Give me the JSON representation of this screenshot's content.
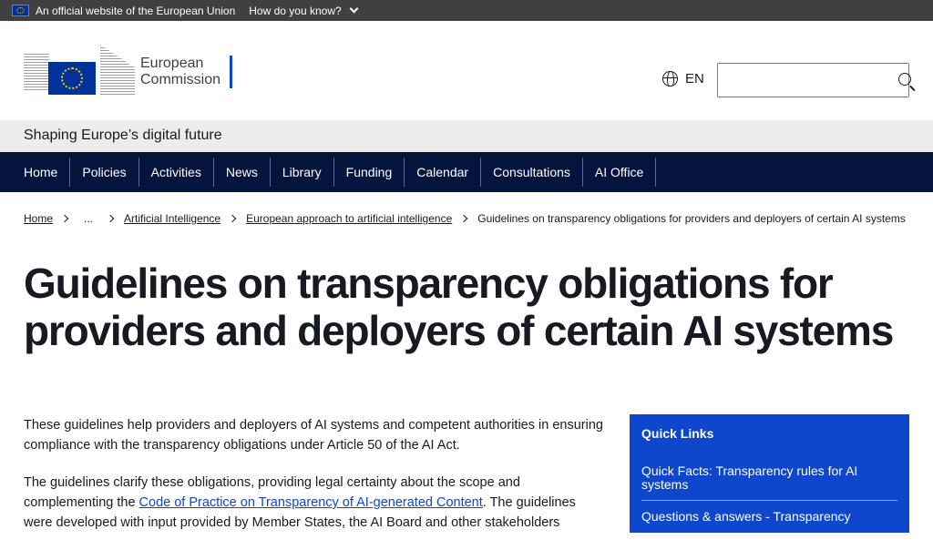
{
  "topbar": {
    "official_text": "An official website of the European Union",
    "how_label": "How do you know?"
  },
  "header": {
    "logo_line1": "European",
    "logo_line2": "Commission",
    "language": "EN",
    "search_placeholder": ""
  },
  "site_name": "Shaping Europe’s digital future",
  "nav": {
    "items": [
      "Home",
      "Policies",
      "Activities",
      "News",
      "Library",
      "Funding",
      "Calendar",
      "Consultations",
      "AI Office"
    ]
  },
  "breadcrumb": {
    "home": "Home",
    "ellipsis": "...",
    "ai": "Artificial Intelligence",
    "approach": "European approach to artificial intelligence",
    "current": "Guidelines on transparency obligations for providers and deployers of certain AI systems"
  },
  "page": {
    "title": "Guidelines on transparency obligations for providers and deployers of certain AI systems",
    "para1": "These guidelines help providers and deployers of AI systems and competent authorities in ensuring compliance with the transparency obligations under Article 50 of the AI Act.",
    "para2_before": "The guidelines clarify these obligations, providing legal certainty about the scope and complementing the ",
    "para2_link": "Code of Practice on Transparency of AI-generated Content",
    "para2_after": ". The guidelines were developed with input provided by Member States, the AI Board and other stakeholders"
  },
  "quick_links": {
    "heading": "Quick Links",
    "links": [
      "Quick Facts: Transparency rules for AI systems",
      "Questions & answers - Transparency"
    ]
  },
  "colors": {
    "nav_bg": "#04143c",
    "accent_blue": "#0e47cb",
    "topbar_bg": "#404040",
    "site_bar_bg": "#ececec"
  }
}
